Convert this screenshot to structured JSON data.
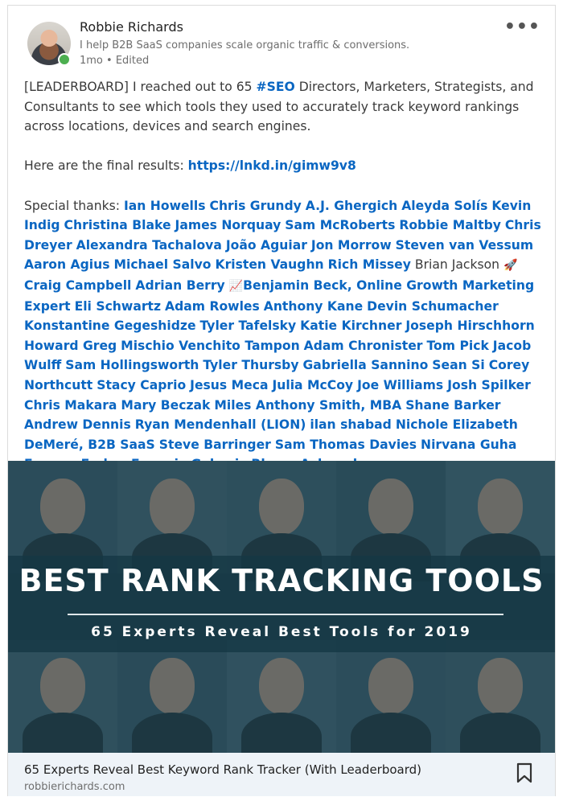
{
  "author": {
    "name": "Robbie Richards",
    "headline": "I help B2B SaaS companies scale organic traffic & conversions.",
    "meta": "1mo • Edited"
  },
  "menu": {
    "more_label": "•••"
  },
  "post": {
    "intro_a": "[LEADERBOARD] I reached out to 65 ",
    "hashtag": "#SEO",
    "intro_b": " Directors, Marketers, Strategists, and Consultants to see which tools they used to accurately track keyword rankings across locations, devices and search engines.",
    "results_label": "Here are the final results: ",
    "results_link": "https://lnkd.in/gimw9v8",
    "thanks_label": "Special thanks: ",
    "m01": "Ian Howells",
    "m02": "Chris Grundy",
    "m03": "A.J. Ghergich",
    "m04": "Aleyda Solís",
    "m05": "Kevin Indig",
    "m06": "Christina Blake",
    "m07": "James Norquay",
    "m08": "Sam McRoberts",
    "m09": "Robbie Maltby",
    "m10": "Chris Dreyer",
    "m11": "Alexandra Tachalova",
    "m12": "João Aguiar",
    "m13": "Jon Morrow",
    "m14": "Steven van Vessum",
    "m15": "Aaron Agius",
    "m16": "Michael Salvo",
    "m17": "Kristen Vaughn",
    "m18": "Rich Missey",
    "plain": "Brian Jackson",
    "rocket": "🚀",
    "m19": "Craig Campbell",
    "m20": "Adrian Berry",
    "chart_emoji": "📈",
    "m21": "Benjamin Beck, Online Growth Marketing Expert",
    "m22": "Eli Schwartz",
    "m23": "Adam Rowles",
    "m24": "Anthony Kane",
    "m25": "Devin Schumacher",
    "m26": "Konstantine Gegeshidze",
    "m27": "Tyler Tafelsky",
    "m28": "Katie Kirchner",
    "m29": "Joseph Hirschhorn",
    "m30": "Howard Greg",
    "m31": "Mischio Venchito Tampon",
    "m32": "Adam Chronister",
    "m33": "Tom Pick",
    "m34": "Jacob Wulff",
    "m35": "Sam Hollingsworth",
    "m36": "Tyler Thursby",
    "m37": "Gabriella Sannino",
    "m38": "Sean Si",
    "m39": "Corey Northcutt",
    "m40": "Stacy Caprio",
    "m41": "Jesus Meca",
    "m42": "Julia McCoy",
    "m43": "Joe Williams",
    "m44": "Josh Spilker",
    "m45": "Chris Makara",
    "m46": "Mary Beczak",
    "m47": "Miles Anthony Smith, MBA",
    "m48": "Shane Barker",
    "m49": "Andrew Dennis",
    "m50": "Ryan Mendenhall (LION)",
    "m51": "ilan shabad",
    "m52": "Nichole Elizabeth DeMeré, B2B SaaS",
    "m53": "Steve Barringer",
    "m54": "Sam Thomas Davies",
    "m55": "Nirvana Guha",
    "m56": "Eugene Farber",
    "m57": "Evgeniy Gakaviy",
    "m58": "Rhona Aylward"
  },
  "banner": {
    "title": "BEST RANK TRACKING TOOLS",
    "subtitle": "65 Experts Reveal Best Tools for 2019"
  },
  "link_preview": {
    "title": "65 Experts Reveal Best Keyword Rank Tracker (With Leaderboard)",
    "domain": "robbierichards.com"
  },
  "colors": {
    "link": "#0a66c2",
    "online": "#4caf50",
    "banner": "#2f4a55"
  }
}
